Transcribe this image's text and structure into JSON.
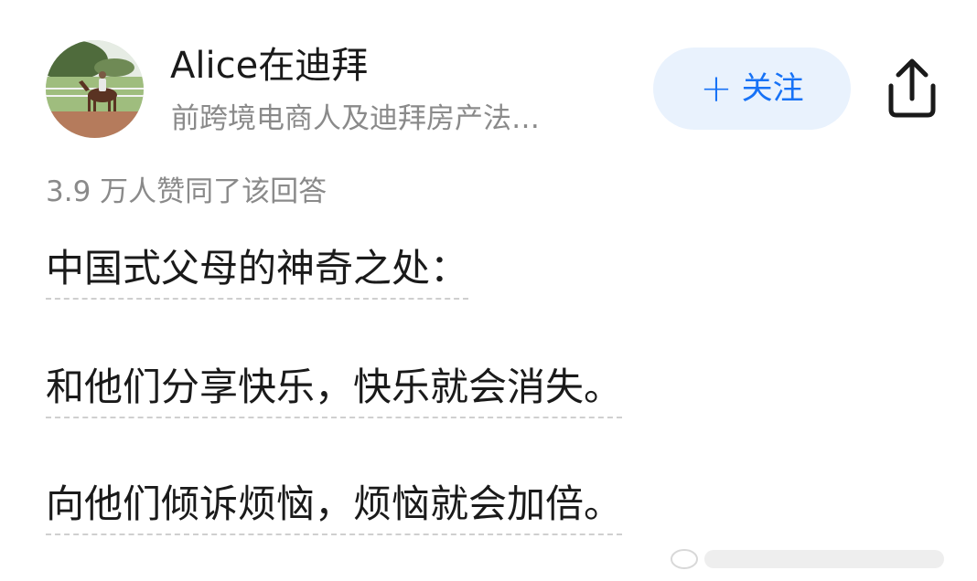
{
  "author": {
    "name": "Alice在迪拜",
    "bio": "前跨境电商人及迪拜房产法…",
    "avatar_icon": "avatar-horse-rider"
  },
  "actions": {
    "follow_plus": "+",
    "follow_label": "关注",
    "share_icon": "share-icon"
  },
  "answer": {
    "vote_text": "3.9 万人赞同了该回答",
    "paragraphs": [
      "中国式父母的神奇之处：",
      "和他们分享快乐，快乐就会消失。",
      "向他们倾诉烦恼，烦恼就会加倍。"
    ]
  },
  "colors": {
    "accent": "#1772f6",
    "follow_bg": "#e9f2fd",
    "text_primary": "#1a1a1a",
    "text_secondary": "#8a8a8a"
  }
}
